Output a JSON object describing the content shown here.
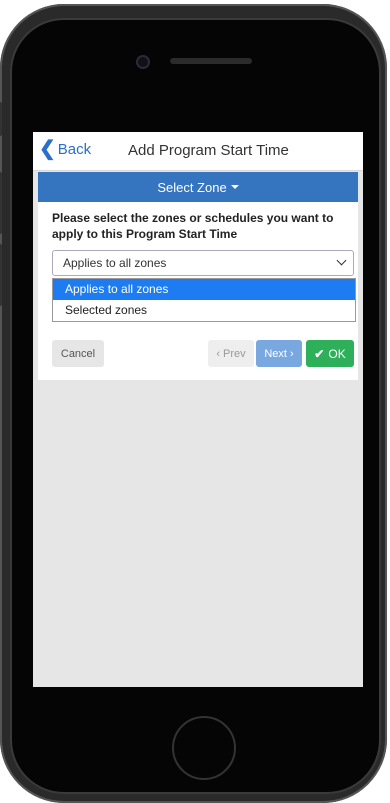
{
  "navbar": {
    "back_label": "Back",
    "title": "Add Program Start Time"
  },
  "panel": {
    "header_label": "Select Zone",
    "prompt": "Please select the zones or schedules you want to apply to this Program Start Time",
    "select_value": "Applies to all zones",
    "options": [
      {
        "label": "Applies to all zones",
        "selected": true
      },
      {
        "label": "Selected zones",
        "selected": false
      }
    ]
  },
  "buttons": {
    "cancel": "Cancel",
    "prev": "‹ Prev",
    "next": "Next ›",
    "ok": "OK"
  },
  "colors": {
    "header_blue": "#3575c0",
    "option_highlight": "#1e7cf2",
    "ok_green": "#2eb05a",
    "next_blue": "#79a8e0"
  }
}
